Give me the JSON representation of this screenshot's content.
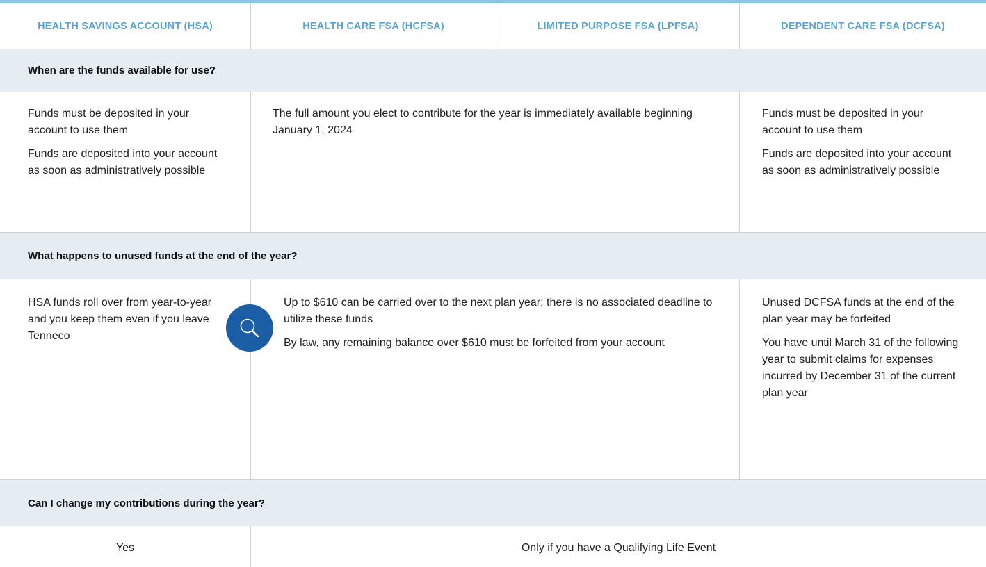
{
  "headers": [
    "HEALTH SAVINGS ACCOUNT (HSA)",
    "HEALTH CARE FSA (HCFSA)",
    "LIMITED PURPOSE FSA (LPFSA)",
    "DEPENDENT CARE FSA (DCFSA)"
  ],
  "sections": [
    {
      "question": "When are the funds available for use?",
      "hsa": [
        "Funds must be deposited in your account to use them",
        "Funds are deposited into your account as soon as administratively possible"
      ],
      "fsa": [
        "The full amount you elect to contribute for the year is immediately available beginning January 1, 2024"
      ],
      "dcfsa": [
        "Funds must be deposited in your account to use them",
        "Funds are deposited into your account as soon as administratively possible"
      ]
    },
    {
      "question": "What happens to unused funds at the end of the year?",
      "hsa": [
        "HSA funds roll over from year-to-year and you keep them even if you leave Tenneco"
      ],
      "fsa": [
        "Up to $610 can be carried over to the next plan year; there is no associated deadline to utilize these funds",
        "By law, any remaining balance over $610 must be forfeited from your account"
      ],
      "dcfsa": [
        "Unused DCFSA funds at the end of the plan year may be forfeited",
        "You have until March 31 of the following year to submit claims for expenses incurred by December 31 of the current plan year"
      ]
    },
    {
      "question": "Can I change my contributions during the year?",
      "hsa": [
        "Yes"
      ],
      "rest": [
        "Only if you have a Qualifying Life Event"
      ]
    }
  ],
  "colors": {
    "header_text": "#5aa4d2",
    "top_bar": "#8ec4e0",
    "section_bg": "#e6edf2",
    "icon_bg": "#1b5ea6"
  },
  "icons": {
    "zoom": "search-icon"
  }
}
